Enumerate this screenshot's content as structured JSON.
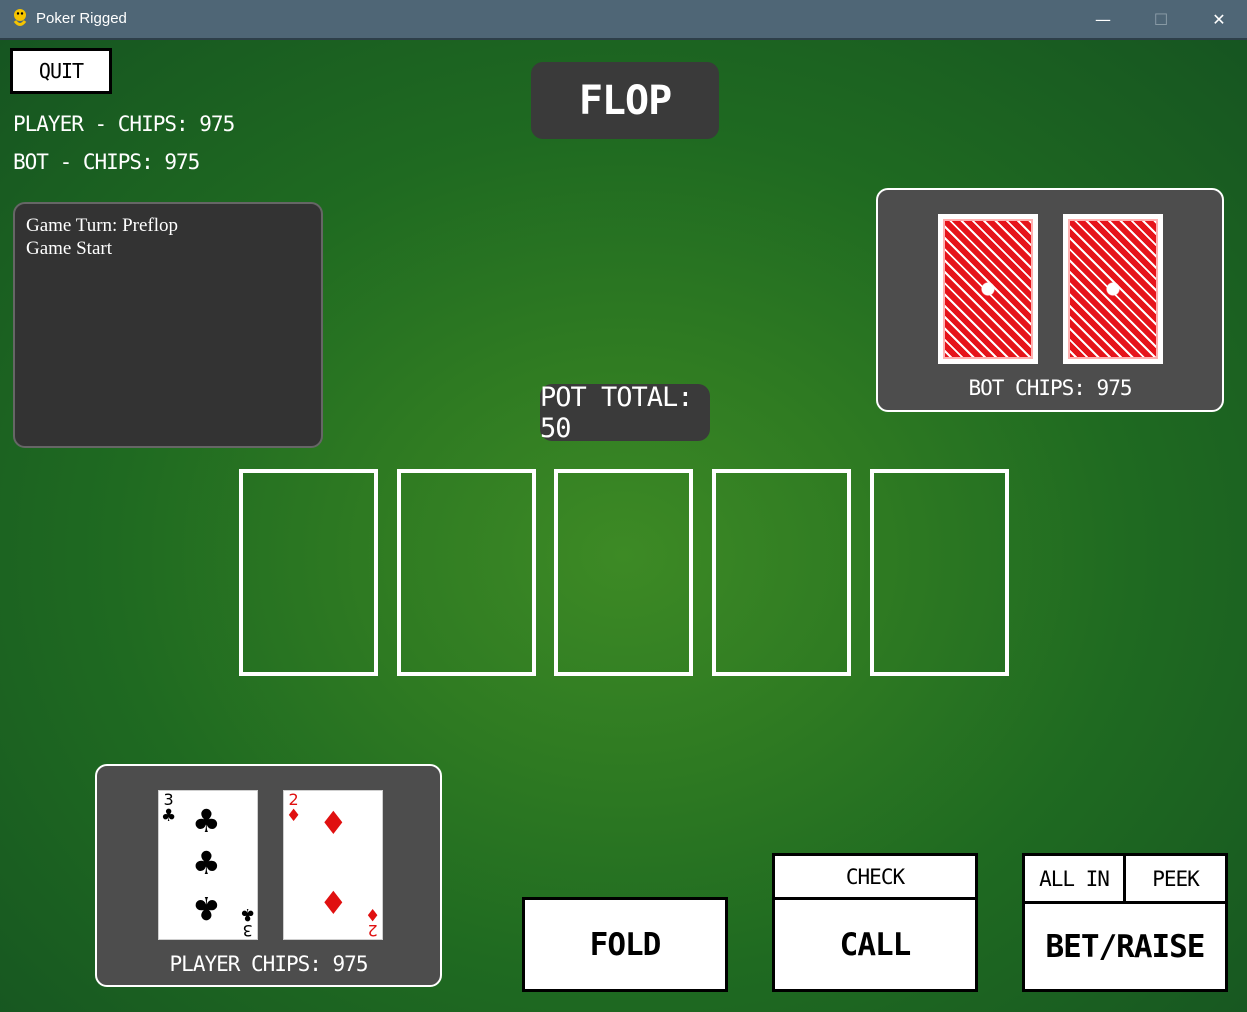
{
  "window": {
    "title": "Poker Rigged",
    "minimize_glyph": "—",
    "maximize_glyph": "☐",
    "close_glyph": "✕"
  },
  "colors": {
    "felt": "#2e7a22",
    "panel": "#4d4d4d",
    "dark_box": "#3a3a3a",
    "card_back_red": "#e6141b"
  },
  "header": {
    "quit_label": "QUIT",
    "player_chips_text": "PLAYER - CHIPS: 975",
    "bot_chips_text": "BOT - CHIPS: 975",
    "phase": "FLOP"
  },
  "log": {
    "lines": [
      "Game Turn: Preflop",
      "Game Start"
    ]
  },
  "bot": {
    "chips_label": "BOT CHIPS: 975",
    "cards": [
      "card-back",
      "card-back"
    ]
  },
  "pot": {
    "label": "POT TOTAL: 50"
  },
  "community": {
    "slots": 5,
    "revealed": 0
  },
  "player": {
    "chips_label": "PLAYER CHIPS: 975",
    "cards": [
      {
        "rank": "3",
        "suit": "♣",
        "color": "black"
      },
      {
        "rank": "2",
        "suit": "♦",
        "color": "red"
      }
    ]
  },
  "actions": {
    "fold": "FOLD",
    "check": "CHECK",
    "call": "CALL",
    "all_in": "ALL IN",
    "peek": "PEEK",
    "bet_raise": "BET/RAISE"
  }
}
